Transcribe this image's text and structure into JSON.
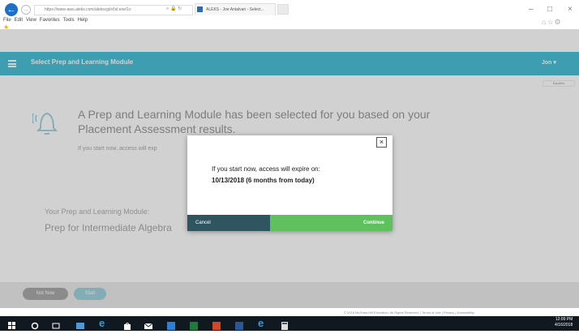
{
  "browser": {
    "url": "https://www-awu.aleks.com/alekscgi/x/Isl.exe/1o",
    "tab_title": "ALEKS - Joe Antalvari - Select...",
    "menu": [
      "File",
      "Edit",
      "View",
      "Favorites",
      "Tools",
      "Help"
    ],
    "back_icon": "arrow-left-icon",
    "forward_icon": "arrow-right-icon",
    "window_controls": [
      "–",
      "□",
      "×"
    ],
    "toolbar_icons": [
      "home-icon",
      "star-icon",
      "gear-icon"
    ]
  },
  "header": {
    "title": "Select Prep and Learning Module",
    "user": "Jon ▾",
    "color": "#4cc1d8"
  },
  "lang_button": "Español",
  "main": {
    "message_line1": "A Prep and Learning Module has been selected for you based on your",
    "message_line2": "Placement Assessment results.",
    "hint": "If you start now, access will exp",
    "module_label": "Your Prep and Learning Module:",
    "module_name": "Prep for Intermediate Algebra"
  },
  "actions": {
    "not_now": "Not Now",
    "start": "Start"
  },
  "modal": {
    "close": "×",
    "message": "If you start now, access will expire on:",
    "date": "10/13/2018 (6 months from today)",
    "cancel": "Cancel",
    "continue": "Continue",
    "cancel_color": "#2e5560",
    "continue_color": "#5fc05e"
  },
  "footer": "© 2018 McGraw-Hill Education. All Rights Reserved. | Terms of Use | Privacy | Accessibility",
  "taskbar": {
    "time": "12:09 PM",
    "date": "4/16/2018"
  }
}
